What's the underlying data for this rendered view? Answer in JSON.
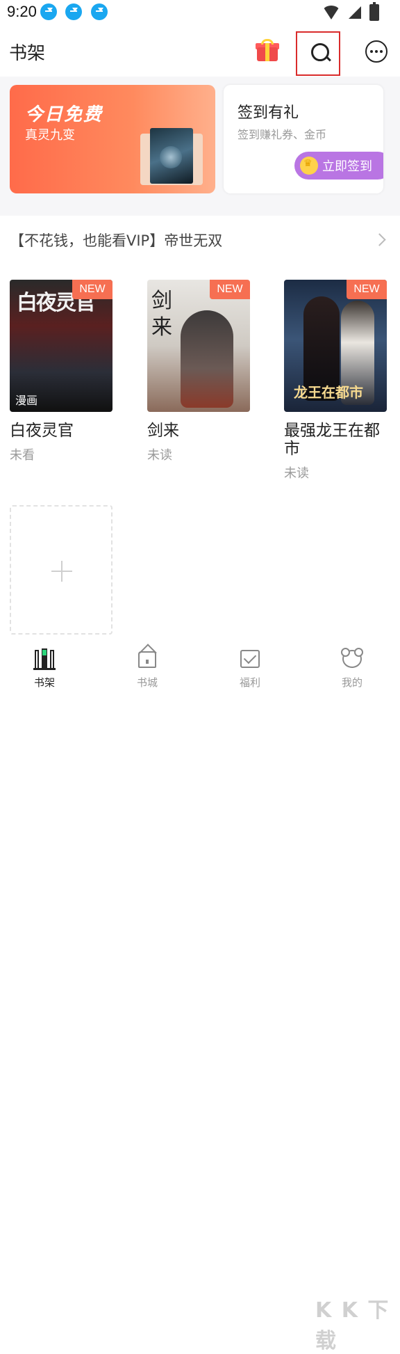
{
  "status_bar": {
    "time": "9:20",
    "icons": [
      "download-icon",
      "download-icon",
      "download-icon",
      "wifi-icon",
      "signal-icon",
      "battery-icon"
    ]
  },
  "header": {
    "title": "书架",
    "icons": [
      "gift-icon",
      "search-icon",
      "more-icon"
    ]
  },
  "banners": {
    "free_today": {
      "title": "今日免费",
      "subtitle": "真灵九变"
    },
    "checkin": {
      "title": "签到有礼",
      "subtitle": "签到赚礼券、金币",
      "button_label": "立即签到"
    }
  },
  "promo": {
    "text": "【不花钱，也能看VIP】帝世无双"
  },
  "books": [
    {
      "title": "白夜灵官",
      "status": "未看",
      "badge": "NEW",
      "type_tag": "漫画",
      "cover_text": "白夜灵官"
    },
    {
      "title": "剑来",
      "status": "未读",
      "badge": "NEW",
      "cover_text": "剑来"
    },
    {
      "title": "最强龙王在都市",
      "status": "未读",
      "badge": "NEW",
      "cover_text": "龙王在都市"
    }
  ],
  "tabs": [
    {
      "label": "书架",
      "active": true,
      "icon": "bookshelf-icon"
    },
    {
      "label": "书城",
      "active": false,
      "icon": "store-icon"
    },
    {
      "label": "福利",
      "active": false,
      "icon": "welfare-icon"
    },
    {
      "label": "我的",
      "active": false,
      "icon": "profile-icon"
    }
  ],
  "watermark": "K K 下载",
  "colors": {
    "accent_orange": "#ff6b4a",
    "checkin_purple": "#b975e3",
    "badge_new": "#f66f52",
    "search_highlight": "#d92b2b"
  }
}
